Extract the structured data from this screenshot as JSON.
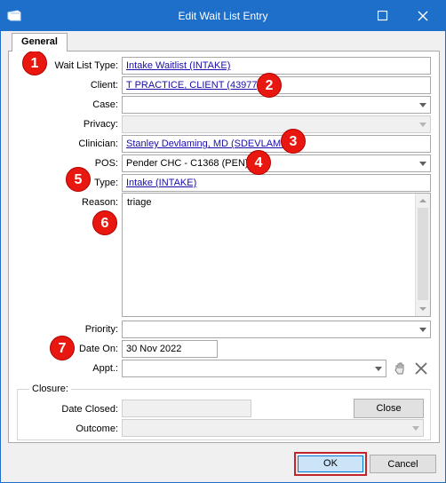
{
  "window": {
    "title": "Edit Wait List Entry"
  },
  "tabs": [
    {
      "label": "General"
    }
  ],
  "form": {
    "wait_list_type": {
      "label": "Wait List Type:",
      "value": "Intake Waitlist (INTAKE)"
    },
    "client": {
      "label": "Client:",
      "value": "T PRACTICE, CLIENT (43977)"
    },
    "case": {
      "label": "Case:",
      "value": ""
    },
    "privacy": {
      "label": "Privacy:",
      "value": ""
    },
    "clinician": {
      "label": "Clinician:",
      "value": "Stanley Devlaming, MD (SDEVLAMI)"
    },
    "pos": {
      "label": "POS:",
      "value": "Pender CHC - C1368 (PEN)"
    },
    "type": {
      "label": "Type:",
      "value": "Intake (INTAKE)"
    },
    "reason": {
      "label": "Reason:",
      "value": "triage"
    },
    "priority": {
      "label": "Priority:",
      "value": ""
    },
    "date_on": {
      "label": "Date On:",
      "value": "30 Nov 2022"
    },
    "appt": {
      "label": "Appt.:",
      "value": ""
    }
  },
  "closure": {
    "title": "Closure:",
    "date_closed": {
      "label": "Date Closed:",
      "value": ""
    },
    "outcome": {
      "label": "Outcome:",
      "value": ""
    },
    "close_button": "Close"
  },
  "buttons": {
    "ok": "OK",
    "cancel": "Cancel"
  },
  "annotations": [
    "1",
    "2",
    "3",
    "4",
    "5",
    "6",
    "7"
  ],
  "colors": {
    "titlebar": "#1e6fc9",
    "badge": "#e8170f",
    "ok_highlight": "#c1262f",
    "link": "#1a0dab"
  },
  "icons": {
    "app": "window-icon",
    "maximize": "maximize-icon",
    "close": "close-icon",
    "appt_pick": "hand-pointer-icon",
    "appt_clear": "clear-x-icon"
  }
}
